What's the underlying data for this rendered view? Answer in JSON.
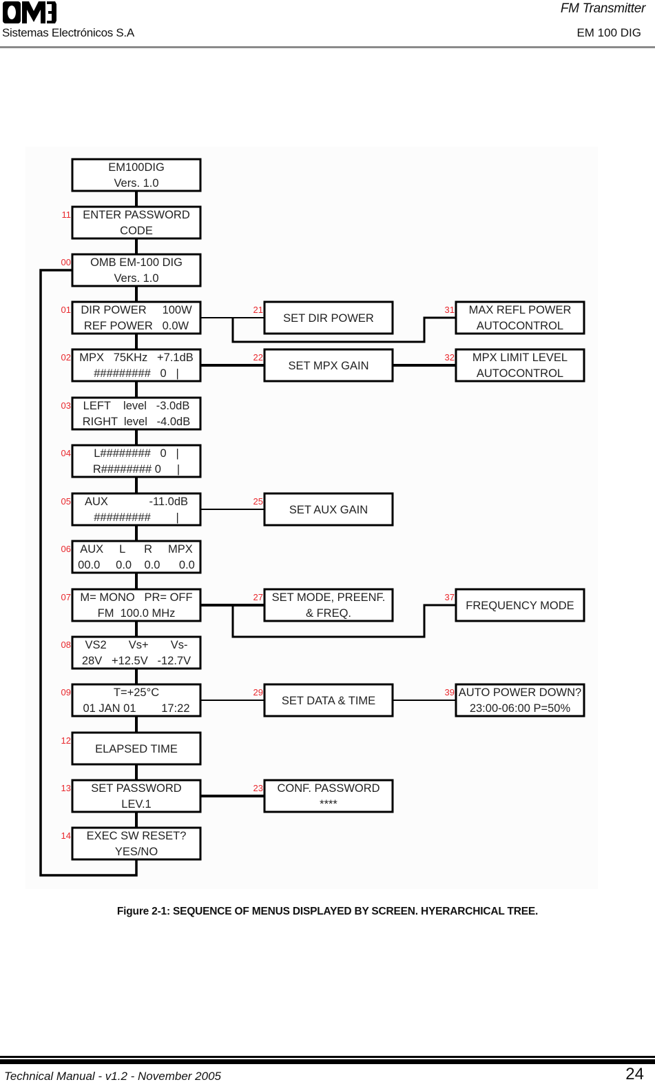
{
  "header": {
    "logo_text": "OMB",
    "company": "Sistemas Electrónicos S.A",
    "product": "FM Transmitter",
    "model": "EM 100 DIG"
  },
  "figure": {
    "caption": "Figure 2-1:  SEQUENCE OF MENUS DISPLAYED BY SCREEN. HYERARCHICAL TREE.",
    "colors": {
      "line": "#000000",
      "label": "#e8262b",
      "text": "#222222",
      "background": "#fcfcfc"
    },
    "menus": [
      {
        "id": "boot",
        "code": "",
        "lines": [
          "EM100DIG",
          "Vers. 1.0"
        ]
      },
      {
        "id": "m11",
        "code": "11",
        "lines": [
          "ENTER PASSWORD",
          "CODE"
        ]
      },
      {
        "id": "m00",
        "code": "00",
        "lines": [
          "OMB EM-100 DIG",
          "Vers. 1.0"
        ]
      },
      {
        "id": "m01",
        "code": "01",
        "lines": [
          "DIR POWER     100W",
          "REF POWER   0.0W"
        ]
      },
      {
        "id": "m02",
        "code": "02",
        "lines": [
          "MPX   75KHz   +7.1dB",
          "#########   0   |"
        ]
      },
      {
        "id": "m03",
        "code": "03",
        "lines": [
          "LEFT    level   -3.0dB",
          "RIGHT  level   -4.0dB"
        ]
      },
      {
        "id": "m04",
        "code": "04",
        "lines": [
          "L########   0   |",
          "R######## 0     |"
        ]
      },
      {
        "id": "m05",
        "code": "05",
        "lines": [
          "AUX             -11.0dB",
          "#########        |"
        ]
      },
      {
        "id": "m06",
        "code": "06",
        "lines": [
          "AUX     L      R     MPX",
          "00.0     0.0    0.0      0.0"
        ]
      },
      {
        "id": "m07",
        "code": "07",
        "lines": [
          "M= MONO   PR= OFF",
          "FM  100.0 MHz"
        ]
      },
      {
        "id": "m08",
        "code": "08",
        "lines": [
          "VS2       Vs+       Vs-",
          "28V   +12.5V   -12.7V"
        ]
      },
      {
        "id": "m09",
        "code": "09",
        "lines": [
          "T=+25°C",
          "01 JAN 01        17:22"
        ]
      },
      {
        "id": "m12",
        "code": "12",
        "lines": [
          "ELAPSED TIME"
        ]
      },
      {
        "id": "m13",
        "code": "13",
        "lines": [
          "SET PASSWORD",
          "LEV.1"
        ]
      },
      {
        "id": "m14",
        "code": "14",
        "lines": [
          "EXEC SW RESET?",
          "YES/NO"
        ]
      },
      {
        "id": "m21",
        "code": "21",
        "lines": [
          "SET DIR POWER"
        ]
      },
      {
        "id": "m22",
        "code": "22",
        "lines": [
          "SET MPX GAIN"
        ]
      },
      {
        "id": "m25",
        "code": "25",
        "lines": [
          "SET AUX GAIN"
        ]
      },
      {
        "id": "m27",
        "code": "27",
        "lines": [
          "SET MODE, PREENF.",
          "& FREQ."
        ]
      },
      {
        "id": "m29",
        "code": "29",
        "lines": [
          "SET DATA & TIME"
        ]
      },
      {
        "id": "m23",
        "code": "23",
        "lines": [
          "CONF. PASSWORD",
          "****"
        ]
      },
      {
        "id": "m31",
        "code": "31",
        "lines": [
          "MAX REFL POWER",
          "AUTOCONTROL"
        ]
      },
      {
        "id": "m32",
        "code": "32",
        "lines": [
          "MPX LIMIT LEVEL",
          "AUTOCONTROL"
        ]
      },
      {
        "id": "m37",
        "code": "37",
        "lines": [
          "FREQUENCY MODE"
        ]
      },
      {
        "id": "m39",
        "code": "39",
        "lines": [
          "AUTO POWER DOWN?",
          "23:00-06:00 P=50%"
        ]
      }
    ],
    "links": [
      [
        "boot",
        "m11"
      ],
      [
        "m11",
        "m00"
      ],
      [
        "m00",
        "m01"
      ],
      [
        "m01",
        "m02"
      ],
      [
        "m02",
        "m03"
      ],
      [
        "m03",
        "m04"
      ],
      [
        "m04",
        "m05"
      ],
      [
        "m05",
        "m06"
      ],
      [
        "m06",
        "m07"
      ],
      [
        "m07",
        "m08"
      ],
      [
        "m08",
        "m09"
      ],
      [
        "m09",
        "m12"
      ],
      [
        "m12",
        "m13"
      ],
      [
        "m13",
        "m14"
      ],
      [
        "m14",
        "m00"
      ],
      [
        "m01",
        "m21"
      ],
      [
        "m01",
        "m31"
      ],
      [
        "m02",
        "m22"
      ],
      [
        "m22",
        "m32"
      ],
      [
        "m05",
        "m25"
      ],
      [
        "m07",
        "m27"
      ],
      [
        "m07",
        "m37"
      ],
      [
        "m09",
        "m29"
      ],
      [
        "m29",
        "m39"
      ],
      [
        "m13",
        "m23"
      ]
    ]
  },
  "footer": {
    "doc": "Technical Manual - v1.2 -  November 2005",
    "page": "24"
  }
}
